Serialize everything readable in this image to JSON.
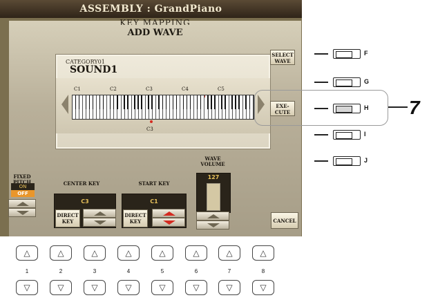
{
  "screen": {
    "title": "ASSEMBLY : GrandPiano",
    "subtitle": "KEY MAPPING",
    "dialog_title": "ADD WAVE"
  },
  "keyboard_box": {
    "category": "CATEGORY01",
    "sound_name": "SOUND1",
    "octave_labels": [
      "C1",
      "C2",
      "C3",
      "C4",
      "C5"
    ],
    "selected_key_label": "C3"
  },
  "side_buttons": {
    "select_wave": "SELECT WAVE",
    "execute": "EXE-CUTE",
    "cancel": "CANCEL"
  },
  "bottom_controls": {
    "fixed_pitch": {
      "label": "FIXED PITCH",
      "on": "ON",
      "off": "OFF"
    },
    "center_key": {
      "label": "CENTER KEY",
      "value": "C3",
      "direct_key": "DIRECT KEY"
    },
    "start_key": {
      "label": "START KEY",
      "value": "C1",
      "direct_key": "DIRECT KEY"
    },
    "wave_volume": {
      "label": "WAVE VOLUME",
      "value": "127",
      "level": 1.0
    }
  },
  "panel_right_buttons": [
    {
      "label": "F"
    },
    {
      "label": "G"
    },
    {
      "label": "H"
    },
    {
      "label": "I"
    },
    {
      "label": "J"
    }
  ],
  "callout": {
    "number": "7"
  },
  "panel_bottom_buttons": {
    "up_glyph": "△",
    "down_glyph": "▽",
    "numbers": [
      "1",
      "2",
      "3",
      "4",
      "5",
      "6",
      "7",
      "8"
    ]
  },
  "colors": {
    "value_text": "#e9c25b",
    "off_highlight": "#e9962b",
    "red_marker": "#d42a20"
  }
}
